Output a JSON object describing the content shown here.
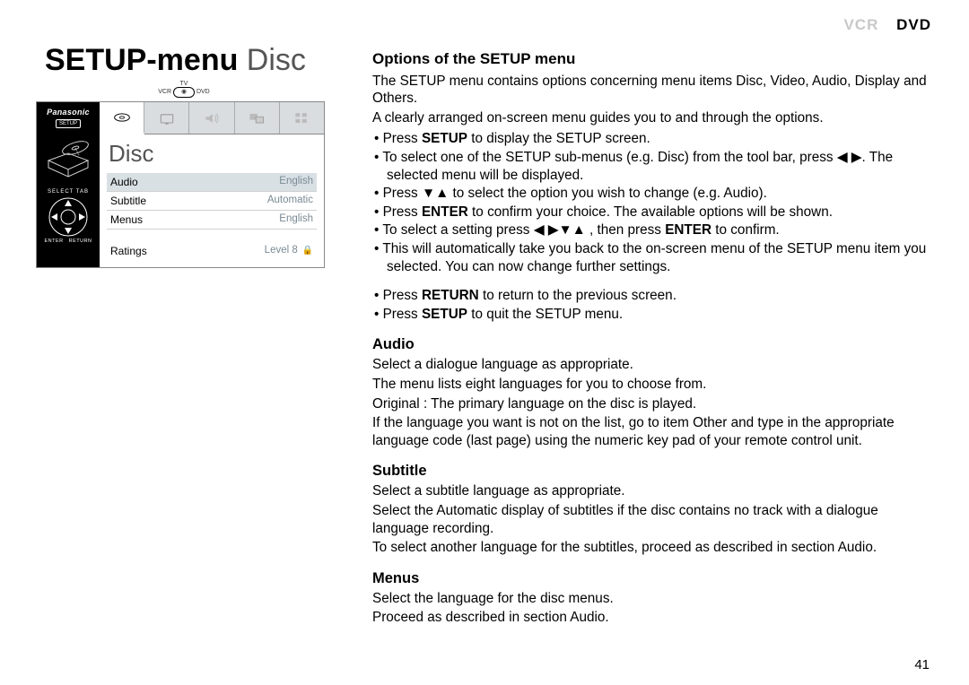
{
  "header": {
    "vcr": "VCR",
    "dvd": "DVD"
  },
  "title": {
    "bold": "SETUP-menu",
    "light": " Disc"
  },
  "indicator": {
    "tv": "TV",
    "vcr": "VCR",
    "dvd": "DVD"
  },
  "osd": {
    "brand": "Panasonic",
    "setup": "SETUP",
    "selectTab": "SELECT   TAB",
    "enter": "ENTER",
    "return": "RETURN",
    "title": "Disc",
    "rows": [
      {
        "label": "Audio",
        "value": "English",
        "sel": true
      },
      {
        "label": "Subtitle",
        "value": "Automatic",
        "sel": false
      },
      {
        "label": "Menus",
        "value": "English",
        "sel": false
      }
    ],
    "ratings": {
      "label": "Ratings",
      "value": "Level 8"
    }
  },
  "content": {
    "h_options": "Options of the SETUP menu",
    "intro1": "The SETUP menu contains options concerning menu items Disc, Video, Audio, Display and Others.",
    "intro2": "A clearly arranged on-screen menu guides you to and through the options.",
    "b1a": "Press ",
    "b1b": "SETUP",
    "b1c": " to display the SETUP screen.",
    "b2a": "To select one of the SETUP sub-menus (e.g. Disc) from the tool bar, press ◀ ▶. The selected menu will be displayed.",
    "b3": "Press ▼▲ to select the option you wish to change (e.g. Audio).",
    "b4a": "Press ",
    "b4b": "ENTER",
    "b4c": " to confirm your choice. The available options will be shown.",
    "b5a": "To select a setting press  ◀ ▶▼▲ , then press ",
    "b5b": "ENTER",
    "b5c": " to confirm.",
    "b6": "This will automatically take you back to the on-screen menu of the SETUP menu item you selected. You can now change further settings.",
    "b7a": "Press ",
    "b7b": "RETURN",
    "b7c": " to return to the previous screen.",
    "b8a": "Press ",
    "b8b": "SETUP",
    "b8c": " to quit the SETUP menu.",
    "h_audio": "Audio",
    "audio1": "Select a dialogue language as appropriate.",
    "audio2": "The menu lists eight languages for you to choose from.",
    "audio3": "Original : The primary language on the disc is played.",
    "audio4": "If the language you want is not on the list, go to item Other and type in the appropriate language code (last page) using the numeric key pad of your remote control unit.",
    "h_subtitle": "Subtitle",
    "sub1": "Select a subtitle language as appropriate.",
    "sub2": "Select the Automatic display of subtitles if the disc contains no track with a dialogue language recording.",
    "sub3": "To select another language for the subtitles, proceed as described in section Audio.",
    "h_menus": "Menus",
    "men1": "Select the language for the disc menus.",
    "men2": "Proceed as described in section Audio."
  },
  "page": "41"
}
